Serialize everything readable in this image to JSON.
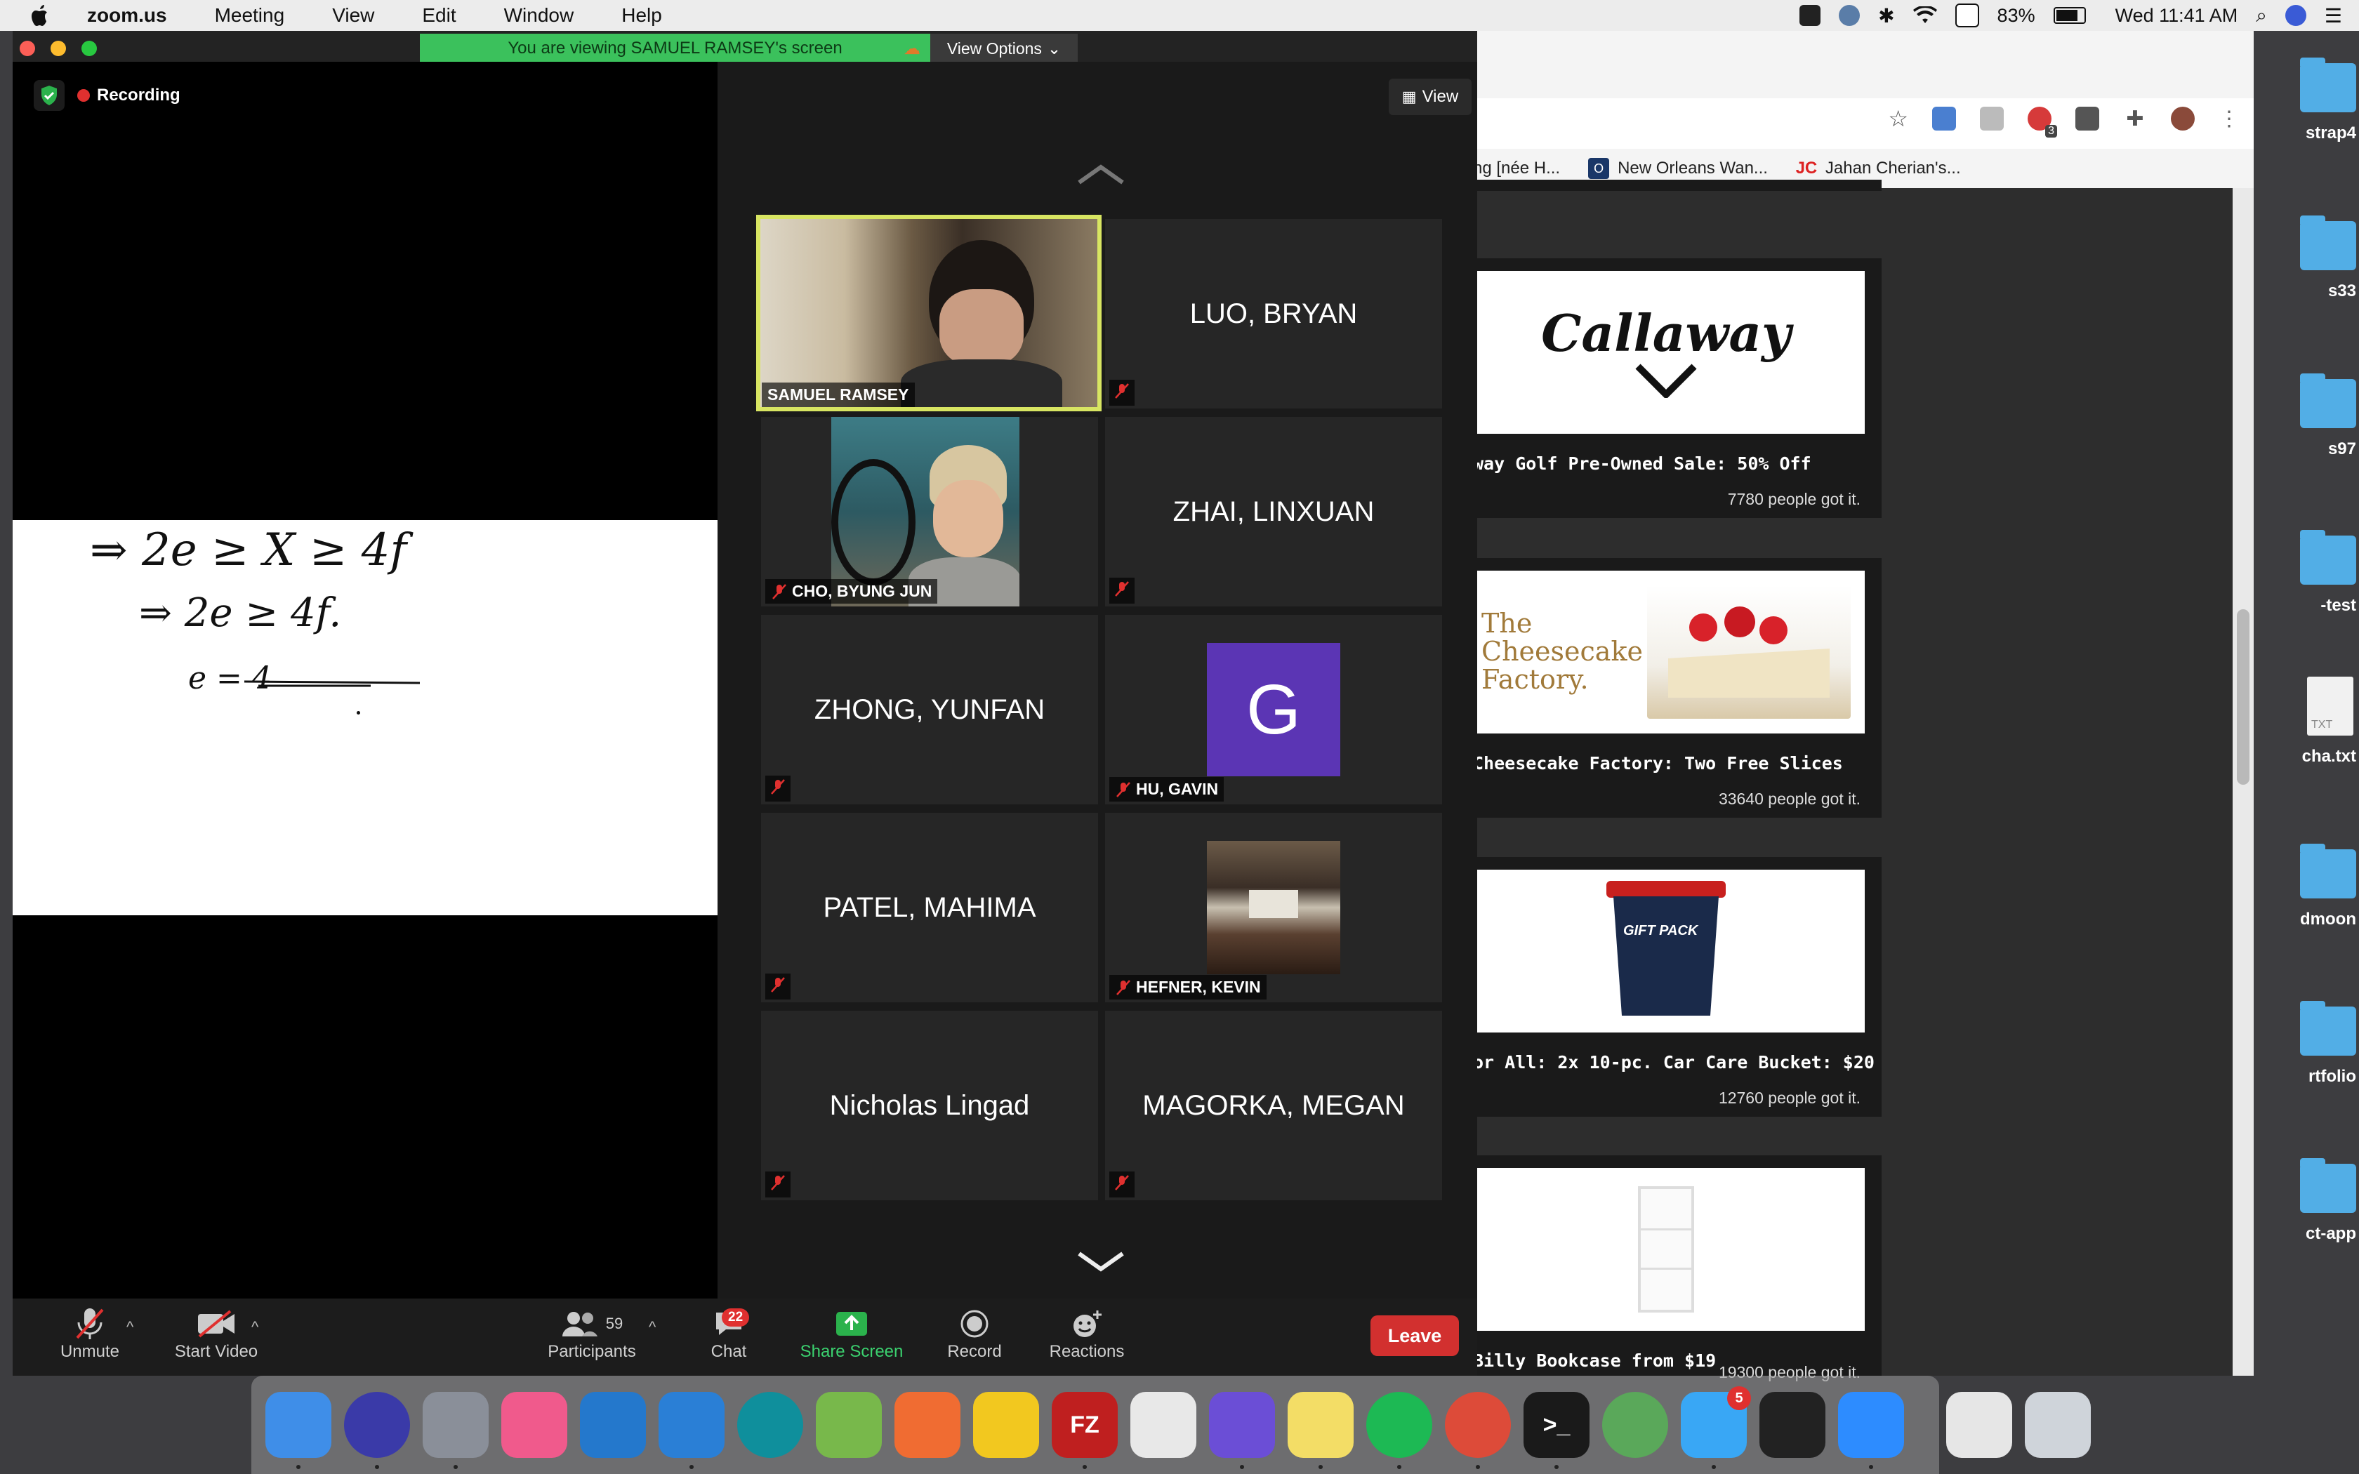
{
  "menubar": {
    "app_name": "zoom.us",
    "menus": [
      "Meeting",
      "View",
      "Edit",
      "Window",
      "Help"
    ],
    "battery": "83%",
    "clock": "Wed 11:41 AM"
  },
  "desktop": {
    "items": [
      {
        "label": "strap4",
        "kind": "folder"
      },
      {
        "label": "s33",
        "kind": "folder"
      },
      {
        "label": "s97",
        "kind": "folder"
      },
      {
        "label": "-test",
        "kind": "folder"
      },
      {
        "label": "cha.txt",
        "kind": "txt",
        "badge": "TXT"
      },
      {
        "label": "dmoon",
        "kind": "folder"
      },
      {
        "label": "rtfolio",
        "kind": "folder"
      },
      {
        "label": "ct-app",
        "kind": "folder"
      }
    ]
  },
  "chrome": {
    "bookmarks": [
      {
        "label": "ng [née H...",
        "icon": ""
      },
      {
        "label": "New Orleans Wan...",
        "icon": "O"
      },
      {
        "label": "Jahan Cherian's...",
        "icon": "JC"
      }
    ],
    "extension_badge": "3",
    "deals": [
      {
        "title": "way Golf Pre-Owned Sale: 50% Off",
        "count": "7780 people got it.",
        "image": "callaway-logo",
        "logo_text": "Callaway"
      },
      {
        "title": "Cheesecake Factory: Two Free Slices",
        "count": "33640 people got it.",
        "image": "cheesecake",
        "logo_text": "The Cheesecake Factory."
      },
      {
        "title": "or All: 2x 10-pc. Car Care Bucket: $20",
        "count": "12760 people got it.",
        "image": "car-care-bucket",
        "logo_text": "GIFT PACK"
      },
      {
        "title": "Billy Bookcase from $19",
        "count": "19300 people got it.",
        "image": "bookcase",
        "logo_text": ""
      }
    ]
  },
  "zoom": {
    "viewing_banner": "You are viewing SAMUEL RAMSEY's screen",
    "view_options": "View Options",
    "recording": "Recording",
    "view_button": "View",
    "whiteboard": {
      "line1": "⇒  2e ≥ X ≥ 4f",
      "line2": "⇒ 2e ≥ 4f.",
      "line3": "e = 4"
    },
    "participants": [
      {
        "name": "SAMUEL RAMSEY",
        "video": true,
        "active": true,
        "muted": false
      },
      {
        "name": "LUO, BRYAN",
        "video": false,
        "muted": true
      },
      {
        "name": "CHO, BYUNG JUN",
        "video": true,
        "muted": true
      },
      {
        "name": "ZHAI, LINXUAN",
        "video": false,
        "muted": true
      },
      {
        "name": "ZHONG, YUNFAN",
        "video": false,
        "muted": true
      },
      {
        "name": "HU, GAVIN",
        "video": false,
        "avatar": "G",
        "muted": true
      },
      {
        "name": "PATEL, MAHIMA",
        "video": false,
        "muted": true
      },
      {
        "name": "HEFNER, KEVIN",
        "video": false,
        "picture": true,
        "muted": true
      },
      {
        "name": "Nicholas Lingad",
        "video": false,
        "muted": true
      },
      {
        "name": "MAGORKA, MEGAN",
        "video": false,
        "muted": true
      }
    ],
    "toolbar": {
      "unmute": "Unmute",
      "start_video": "Start Video",
      "participants": "Participants",
      "participant_count": "59",
      "chat": "Chat",
      "chat_badge": "22",
      "share_screen": "Share Screen",
      "record": "Record",
      "reactions": "Reactions",
      "leave": "Leave"
    }
  },
  "dock": {
    "apps": [
      {
        "name": "finder-icon",
        "color": "#3f8ee8"
      },
      {
        "name": "siri-icon",
        "color": "#3a3aa8"
      },
      {
        "name": "launchpad-icon",
        "color": "#8a8f99"
      },
      {
        "name": "itunes-icon",
        "color": "#f05a8c"
      },
      {
        "name": "vscode-icon",
        "color": "#2478cc"
      },
      {
        "name": "xcode-icon",
        "color": "#2a7fd6"
      },
      {
        "name": "arduino-icon",
        "color": "#0f8f9c"
      },
      {
        "name": "android-studio-icon",
        "color": "#78b84b"
      },
      {
        "name": "postman-icon",
        "color": "#f06c32"
      },
      {
        "name": "cyberduck-icon",
        "color": "#f2c81f"
      },
      {
        "name": "filezilla-icon",
        "color": "#bf1f1f",
        "glyph": "FZ"
      },
      {
        "name": "textedit-icon",
        "color": "#e8e8e8"
      },
      {
        "name": "imovie-icon",
        "color": "#6b4ed6"
      },
      {
        "name": "stickies-icon",
        "color": "#f3dd66"
      },
      {
        "name": "spotify-icon",
        "color": "#1db954"
      },
      {
        "name": "chrome-icon",
        "color": "#dd4b39"
      },
      {
        "name": "terminal-icon",
        "color": "#1a1a1a",
        "glyph": ">_"
      },
      {
        "name": "network-icon",
        "color": "#5aa85a"
      },
      {
        "name": "messages-icon",
        "color": "#39a7f5",
        "badge": "5"
      },
      {
        "name": "piano-icon",
        "color": "#222222"
      },
      {
        "name": "zoom-icon",
        "color": "#2d8cff"
      },
      {
        "name": "document-icon",
        "color": "#e6e6e6"
      },
      {
        "name": "trash-icon",
        "color": "#cfd4da"
      }
    ]
  }
}
